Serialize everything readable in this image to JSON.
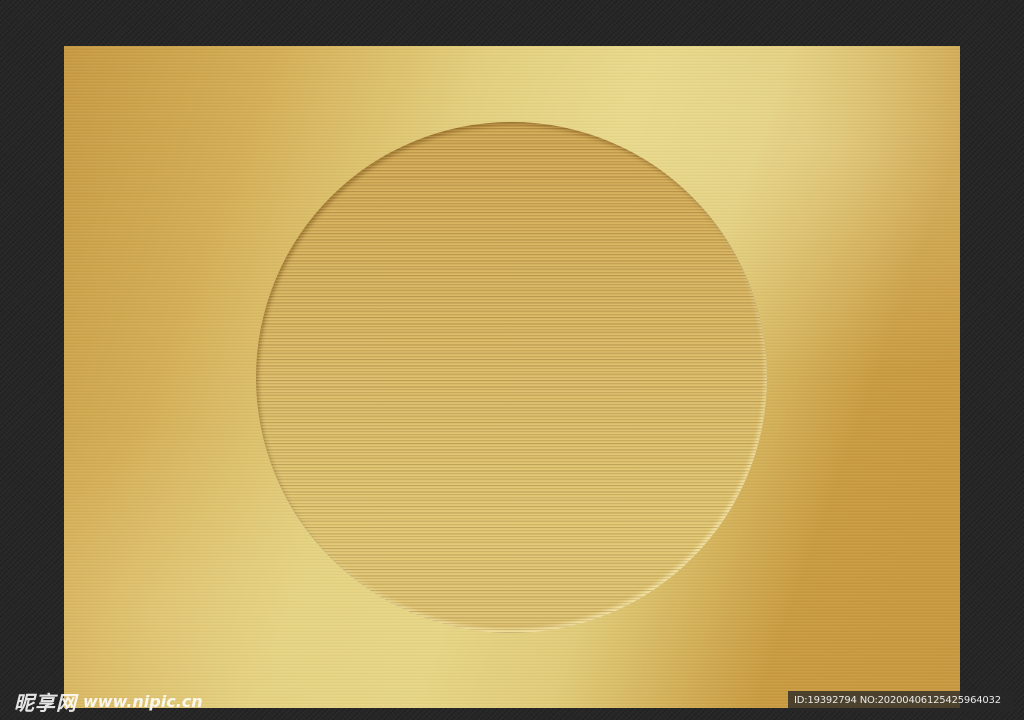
{
  "watermark": {
    "site_name_cn": "昵享网",
    "site_url": "www.nipic.cn",
    "image_id_text": "ID:19392794 NO:20200406125425964032"
  },
  "colors": {
    "background": "#262626",
    "gold_light": "#e6d584",
    "gold_dark": "#c69a42",
    "disc_gold": "#d8b866"
  }
}
